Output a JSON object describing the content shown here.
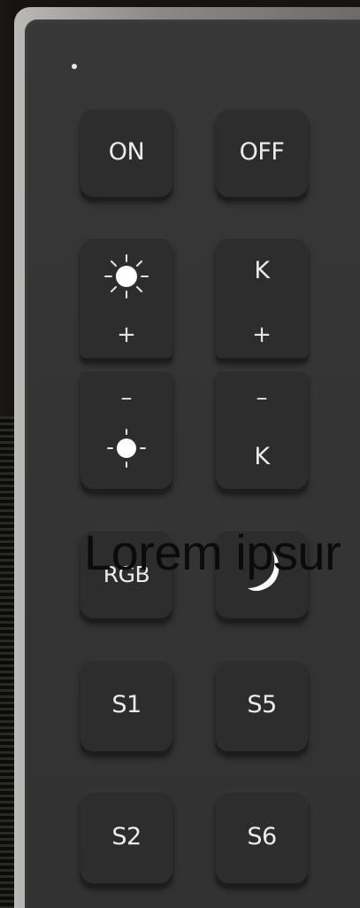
{
  "remote": {
    "buttons": {
      "on": "ON",
      "off": "OFF",
      "brightness_up": {
        "plus": "+"
      },
      "cct_up": {
        "label": "K",
        "plus": "+"
      },
      "brightness_down": {
        "minus": "–"
      },
      "cct_down": {
        "label": "K",
        "minus": "–"
      },
      "rgb": "RGB",
      "s1": "S1",
      "s5": "S5",
      "s2": "S2",
      "s6": "S6"
    },
    "icons": {
      "brightness": "sun-icon",
      "night_mode": "crescent-moon-icon"
    },
    "colors": {
      "body": "#353535",
      "key": "#2d2d2d",
      "bezel": "#a9aaa8",
      "label": "#ececec"
    }
  },
  "overlay": {
    "text": "Lorem ipsur"
  }
}
